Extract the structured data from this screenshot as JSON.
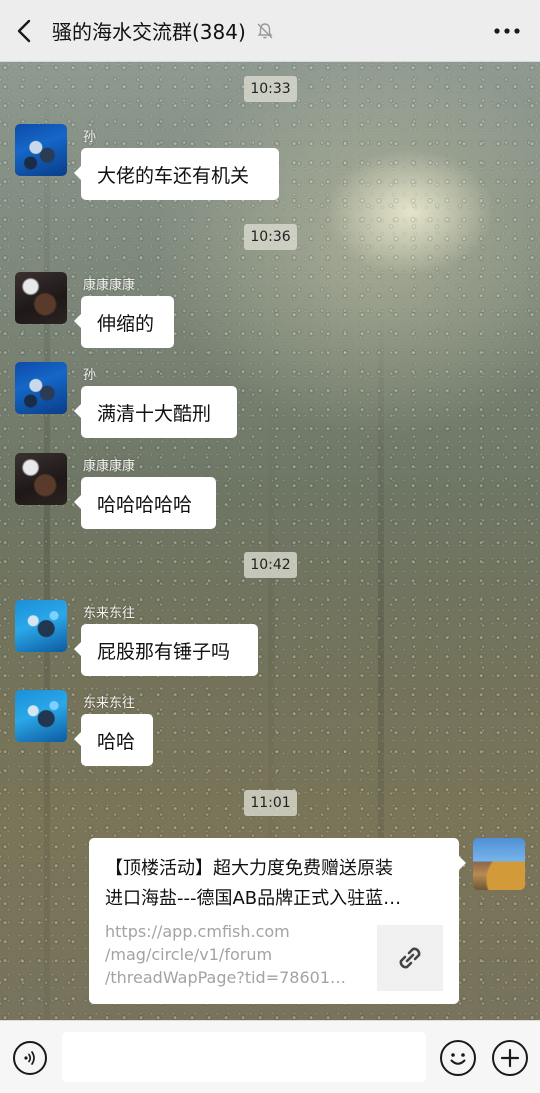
{
  "header": {
    "title": "骚的海水交流群(384)",
    "back_icon": "chevron-left-icon",
    "mute_icon": "bell-off-icon",
    "more_icon": "more-dots-icon"
  },
  "messages": [
    {
      "type": "time",
      "text": "10:33"
    },
    {
      "type": "text",
      "sender": "孙",
      "avatar": "diver",
      "text": "大佬的车还有机关"
    },
    {
      "type": "time",
      "text": "10:36"
    },
    {
      "type": "text",
      "sender": "康康康康",
      "avatar": "dark",
      "text": "伸缩的"
    },
    {
      "type": "text",
      "sender": "孙",
      "avatar": "diver",
      "text": "满清十大酷刑"
    },
    {
      "type": "text",
      "sender": "康康康康",
      "avatar": "dark",
      "text": "哈哈哈哈哈"
    },
    {
      "type": "time",
      "text": "10:42"
    },
    {
      "type": "text",
      "sender": "东来东往",
      "avatar": "diver2",
      "text": "屁股那有锤子吗"
    },
    {
      "type": "text",
      "sender": "东来东往",
      "avatar": "diver2",
      "text": "哈哈"
    },
    {
      "type": "time",
      "text": "11:01"
    },
    {
      "type": "link",
      "outgoing": true,
      "avatar": "landscape",
      "title_line1": "【顶楼活动】超大力度免费赠送原装",
      "title_line2": "进口海盐---德国AB品牌正式入驻蓝…",
      "url_line1": "https://app.cmfish.com",
      "url_line2": "/mag/circle/v1/forum",
      "url_line3": "/threadWapPage?tid=786014…",
      "thumb_icon": "link-icon"
    }
  ],
  "input_bar": {
    "voice_icon": "voice-icon",
    "emoji_icon": "emoji-icon",
    "plus_icon": "plus-icon",
    "text_value": ""
  },
  "colors": {
    "header_bg": "#ededed",
    "bubble_bg": "#ffffff",
    "time_pill_bg": "#dcdcd2"
  }
}
